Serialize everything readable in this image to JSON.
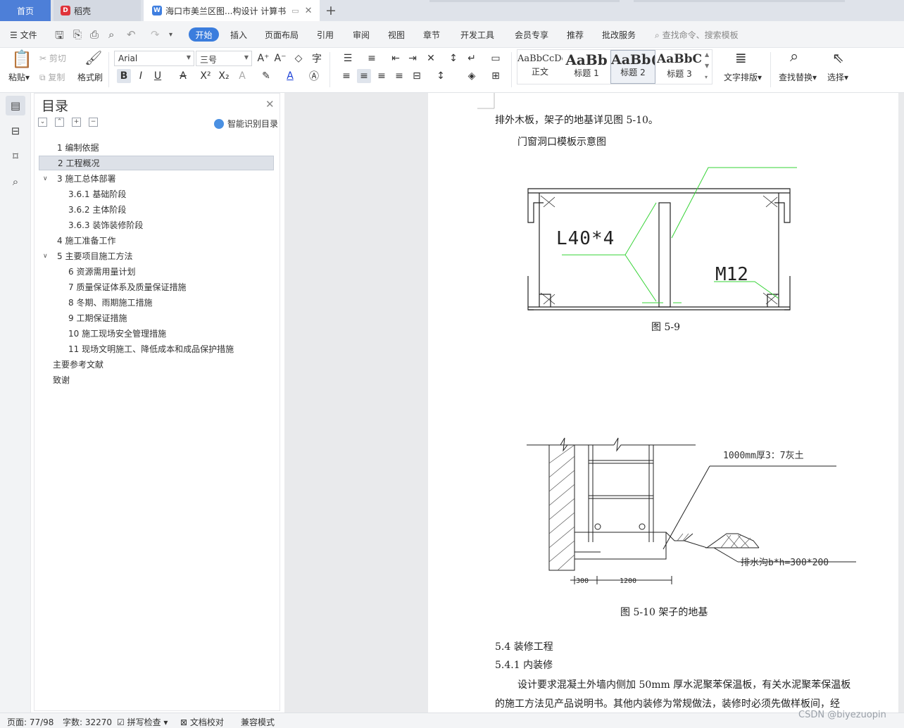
{
  "tabs": {
    "home": "首页",
    "daoke": "稻壳",
    "doc": "海口市美兰区图...构设计 计算书",
    "plus": "+"
  },
  "menu": {
    "file": "文件",
    "items": [
      "开始",
      "插入",
      "页面布局",
      "引用",
      "审阅",
      "视图",
      "章节",
      "开发工具",
      "会员专享",
      "推荐",
      "批改服务"
    ],
    "search": "查找命令、搜索模板"
  },
  "ribbon": {
    "paste": "粘贴",
    "cut": "剪切",
    "copy": "复制",
    "format_painter": "格式刷",
    "font_name": "Arial",
    "font_size": "三号",
    "styles": [
      {
        "sample": "AaBbCcDd",
        "name": "正文"
      },
      {
        "sample": "AaBb",
        "name": "标题 1"
      },
      {
        "sample": "AaBb(",
        "name": "标题 2"
      },
      {
        "sample": "AaBbC",
        "name": "标题 3"
      }
    ],
    "text_layout": "文字排版",
    "find_replace": "查找替换",
    "select": "选择"
  },
  "toc": {
    "title": "目录",
    "smart": "智能识别目录",
    "items": [
      {
        "text": "1   编制依据",
        "level": 1,
        "expand": false
      },
      {
        "text": "2   工程概况",
        "level": 1,
        "expand": false,
        "active": true
      },
      {
        "text": "3   施工总体部署",
        "level": 1,
        "expand": true
      },
      {
        "text": "3.6.1  基础阶段",
        "level": 2,
        "expand": false
      },
      {
        "text": "3.6.2  主体阶段",
        "level": 2,
        "expand": false
      },
      {
        "text": "3.6.3  装饰装修阶段",
        "level": 2,
        "expand": false
      },
      {
        "text": "4   施工准备工作",
        "level": 1,
        "expand": false
      },
      {
        "text": "5   主要项目施工方法",
        "level": 1,
        "expand": true
      },
      {
        "text": "6   资源需用量计划",
        "level": 2,
        "expand": false
      },
      {
        "text": "7   质量保证体系及质量保证措施",
        "level": 2,
        "expand": false
      },
      {
        "text": "8   冬期、雨期施工措施",
        "level": 2,
        "expand": false
      },
      {
        "text": "9   工期保证措施",
        "level": 2,
        "expand": false
      },
      {
        "text": "10   施工现场安全管理措施",
        "level": 2,
        "expand": false
      },
      {
        "text": "11   现场文明施工、降低成本和成品保护措施",
        "level": 2,
        "expand": false
      },
      {
        "text": "主要参考文献",
        "level": 0,
        "expand": false
      },
      {
        "text": "致谢",
        "level": 0,
        "expand": false
      }
    ]
  },
  "doc": {
    "line1": "排外木板，架子的地基详见图 5-10。",
    "line2": "门窗洞口模板示意图",
    "fig1_label_a": "L40*4",
    "fig1_label_b": "M12",
    "fig1_caption": "图 5-9",
    "fig2_label_a": "1000mm厚3：7灰土",
    "fig2_label_b": "排水沟b*h=300*200",
    "fig2_dim_a": "300",
    "fig2_dim_b": "1200",
    "fig2_caption": "图 5-10 架子的地基",
    "h1": "5.4 装修工程",
    "h2": "5.4.1 内装修",
    "p1": "设计要求混凝土外墙内侧加 50mm 厚水泥聚苯保温板，有关水泥聚苯保温板",
    "p2": "的施工方法见产品说明书。其他内装修为常规做法，装修时必须先做样板间，经"
  },
  "status": {
    "page": "页面: 77/98",
    "words": "字数: 32270",
    "spell": "拼写检查",
    "proof": "文档校对",
    "compat": "兼容模式"
  },
  "watermark": "CSDN @biyezuopin"
}
